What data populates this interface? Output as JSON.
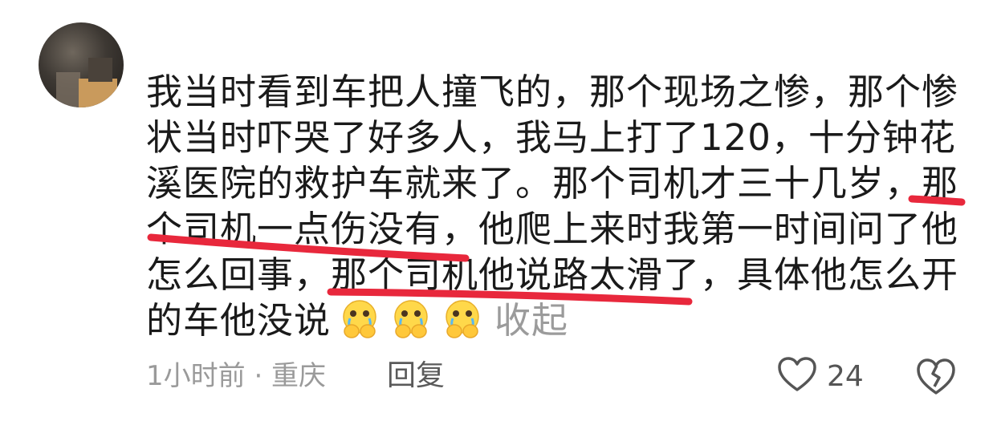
{
  "comment": {
    "lines": [
      "我当时看到车把人撞飞的，那个现场之惨，那个惨",
      "状当时吓哭了好多人，我马上打了120，十分钟花",
      "溪医院的救护车就来了。那个司机才三十几岁，那",
      "个司机一点伤没有，他爬上来时我第一时间问了他",
      "怎么回事，那个司机他说路太滑了，具体他怎么开",
      "的车他没说"
    ],
    "emojis": [
      "crying-face-hands-icon",
      "crying-face-hands-icon",
      "crying-face-hands-icon"
    ],
    "collapse_label": "收起"
  },
  "footer": {
    "meta": "1小时前 · 重庆",
    "reply_label": "回复",
    "like_count": "24"
  },
  "colors": {
    "text": "#1a1a1a",
    "muted": "#9a9a9a",
    "highlight_stroke": "#e8283c"
  }
}
